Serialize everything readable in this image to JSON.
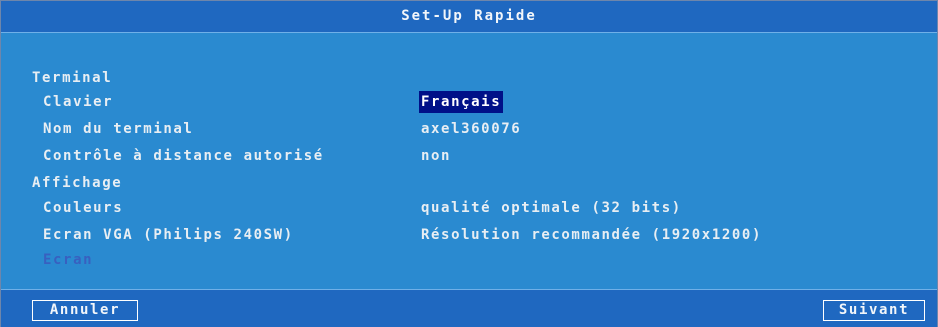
{
  "title": "Set-Up Rapide",
  "sections": {
    "terminal": "Terminal",
    "display": "Affichage"
  },
  "fields": {
    "keyboard": {
      "label": "Clavier",
      "value": "Français"
    },
    "terminal_name": {
      "label": "Nom du terminal",
      "value": "axel360076"
    },
    "remote_control": {
      "label": "Contrôle à distance autorisé",
      "value": "non"
    },
    "colors": {
      "label": "Couleurs",
      "value": "qualité optimale (32 bits)"
    },
    "vga_screen": {
      "label": "Ecran VGA (Philips 240SW)",
      "value": "Résolution recommandée (1920x1200)"
    },
    "screen": {
      "label": "Ecran"
    }
  },
  "buttons": {
    "cancel": "Annuler",
    "next": "Suivant"
  },
  "colors": {
    "background": "#2a8ad0",
    "titlebar": "#1f68c0",
    "selection": "#001088",
    "text": "#e8eef3",
    "disabled_text": "#3860c0"
  }
}
